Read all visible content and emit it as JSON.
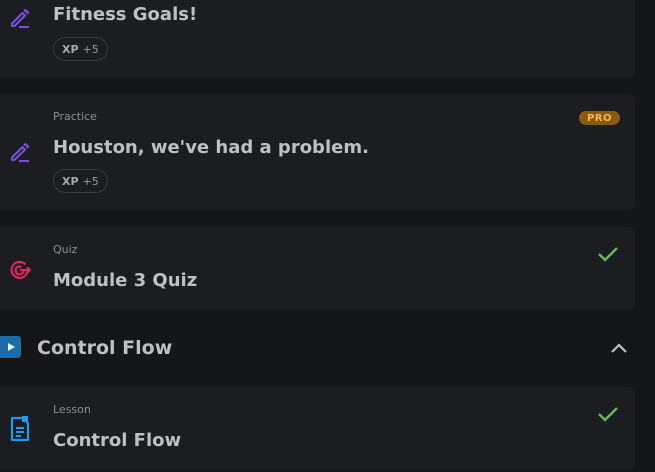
{
  "cards": [
    {
      "type": "",
      "title": "Fitness Goals!",
      "xp_label": "XP",
      "xp_value": "+5",
      "icon": "pencil-icon"
    },
    {
      "type": "Practice",
      "title": "Houston, we've had a problem.",
      "xp_label": "XP",
      "xp_value": "+5",
      "badge": "PRO",
      "icon": "pencil-icon"
    },
    {
      "type": "Quiz",
      "title": "Module 3 Quiz",
      "icon": "target-icon",
      "status": "completed"
    }
  ],
  "section": {
    "title": "Control Flow",
    "icon": "play-icon",
    "state": "expanded"
  },
  "section_items": [
    {
      "type": "Lesson",
      "title": "Control Flow",
      "icon": "document-icon",
      "status": "completed"
    }
  ],
  "colors": {
    "practice_icon": "#7b4fe0",
    "quiz_icon": "#e0245e",
    "lesson_icon": "#1d9bf0",
    "check": "#5cb85c",
    "pro_badge": "#8a5a0f"
  }
}
